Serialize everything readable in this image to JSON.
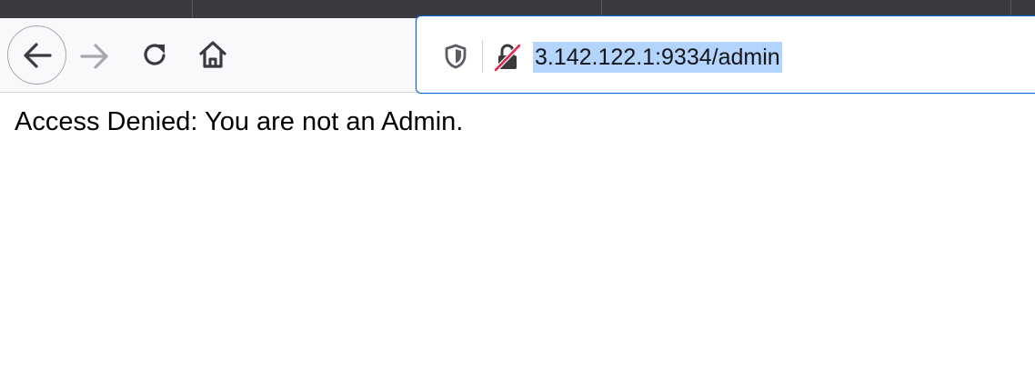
{
  "browser": {
    "address_bar": {
      "url": "3.142.122.1:9334/admin",
      "security_icon": "insecure-lock-icon",
      "tracking_icon": "shield-icon"
    },
    "nav_icons": [
      "back-arrow-icon",
      "forward-arrow-icon",
      "reload-icon",
      "home-icon"
    ],
    "colors": {
      "tabstrip": "#3b3b3f",
      "toolbar": "#f9f9fb",
      "focus_ring": "#0a68cf",
      "selection": "#b3d4fc",
      "insecure_slash": "#e22850"
    }
  },
  "page": {
    "message": "Access Denied: You are not an Admin."
  }
}
